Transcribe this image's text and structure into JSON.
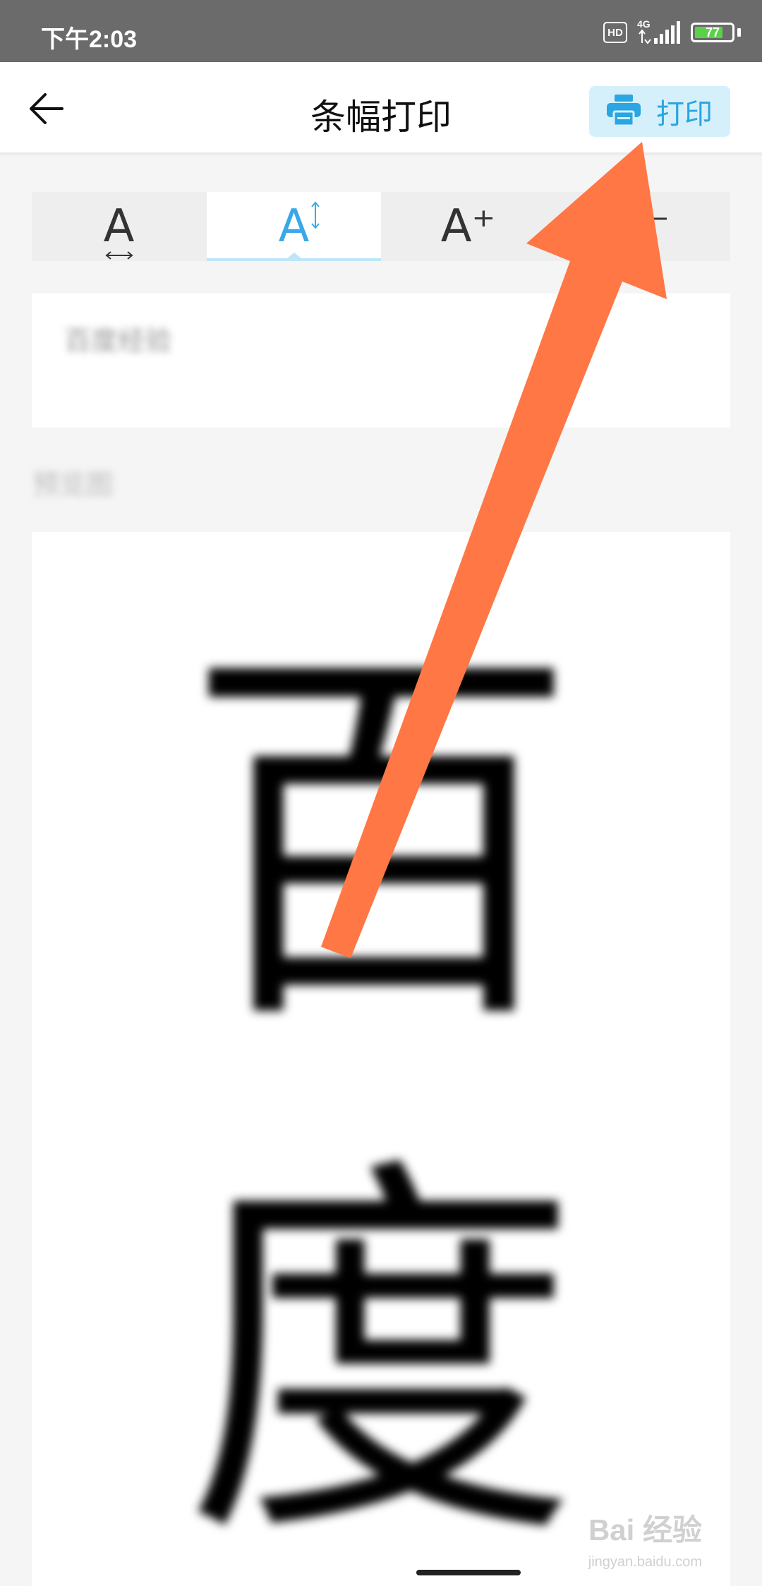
{
  "status_bar": {
    "time": "下午2:03",
    "hd_label": "HD",
    "network_label": "4G",
    "battery_level": "77",
    "battery_fraction": 0.77,
    "battery_color": "#5cd04a"
  },
  "app_bar": {
    "back_icon": "back-arrow-icon",
    "title": "条幅打印",
    "print_button": {
      "label": "打印",
      "icon": "printer-icon",
      "color": "#2aa6e2",
      "background": "#d6f0fb"
    }
  },
  "toolbar": {
    "tools": [
      {
        "icon": "letter-spacing-icon",
        "glyph": "A",
        "active": false
      },
      {
        "icon": "line-height-icon",
        "glyph": "A",
        "active": true
      },
      {
        "icon": "font-size-increase-icon",
        "glyph": "A⁺",
        "active": false
      },
      {
        "icon": "font-size-decrease-icon",
        "glyph": "A⁻",
        "active": false
      }
    ],
    "active_color": "#3aa8e8"
  },
  "input": {
    "value": "百度经验"
  },
  "section": {
    "label": "预览图"
  },
  "preview": {
    "characters": [
      "百",
      "度"
    ]
  },
  "watermark": {
    "brand": "Bai 经验",
    "url": "jingyan.baidu.com"
  },
  "annotation": {
    "arrow_color": "#ff7744",
    "target": "print-button"
  }
}
